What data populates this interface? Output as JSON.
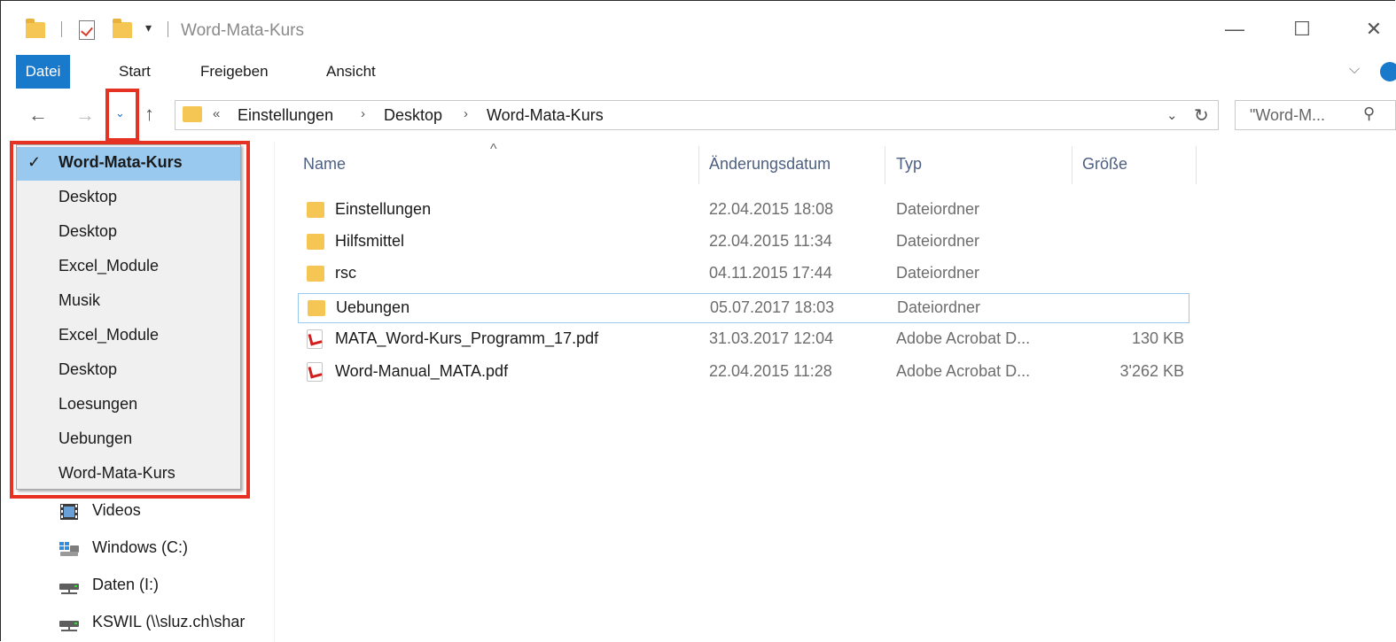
{
  "window": {
    "title": "Word-Mata-Kurs",
    "quick_access_dropdown": "▾",
    "minimize": "—",
    "maximize": "☐",
    "close": "✕"
  },
  "ribbon": {
    "tabs": [
      "Datei",
      "Start",
      "Freigeben",
      "Ansicht"
    ],
    "expand_chevron": "⌵"
  },
  "navigation": {
    "back": "←",
    "forward": "→",
    "recent_dropdown": "⌄",
    "up": "↑"
  },
  "address_bar": {
    "overflow": "«",
    "breadcrumbs": [
      "Einstellungen",
      "Desktop",
      "Word-Mata-Kurs"
    ],
    "separator": "›",
    "dropdown": "⌄",
    "refresh": "↻"
  },
  "search": {
    "placeholder": "\"Word-M...",
    "icon": "search-icon"
  },
  "columns": {
    "sort_indicator": "^",
    "name": "Name",
    "date": "Änderungsdatum",
    "type": "Typ",
    "size": "Größe"
  },
  "files": [
    {
      "name": "Einstellungen",
      "date": "22.04.2015 18:08",
      "type": "Dateiordner",
      "size": "",
      "icon": "folder-icon"
    },
    {
      "name": "Hilfsmittel",
      "date": "22.04.2015 11:34",
      "type": "Dateiordner",
      "size": "",
      "icon": "folder-icon"
    },
    {
      "name": "rsc",
      "date": "04.11.2015 17:44",
      "type": "Dateiordner",
      "size": "",
      "icon": "folder-icon"
    },
    {
      "name": "Uebungen",
      "date": "05.07.2017 18:03",
      "type": "Dateiordner",
      "size": "",
      "icon": "folder-icon"
    },
    {
      "name": "MATA_Word-Kurs_Programm_17.pdf",
      "date": "31.03.2017 12:04",
      "type": "Adobe Acrobat D...",
      "size": "130 KB",
      "icon": "pdf-icon"
    },
    {
      "name": "Word-Manual_MATA.pdf",
      "date": "22.04.2015 11:28",
      "type": "Adobe Acrobat D...",
      "size": "3'262 KB",
      "icon": "pdf-icon"
    }
  ],
  "recent_locations": {
    "check_mark": "✓",
    "items": [
      "Word-Mata-Kurs",
      "Desktop",
      "Desktop",
      "Excel_Module",
      "Musik",
      "Excel_Module",
      "Desktop",
      "Loesungen",
      "Uebungen",
      "Word-Mata-Kurs"
    ]
  },
  "nav_pane": [
    {
      "label": "Videos",
      "icon": "videos-icon"
    },
    {
      "label": "Windows (C:)",
      "icon": "windows-drive-icon"
    },
    {
      "label": "Daten (I:)",
      "icon": "network-drive-icon"
    },
    {
      "label": "KSWIL (\\\\sluz.ch\\shar",
      "icon": "network-drive-icon"
    }
  ]
}
